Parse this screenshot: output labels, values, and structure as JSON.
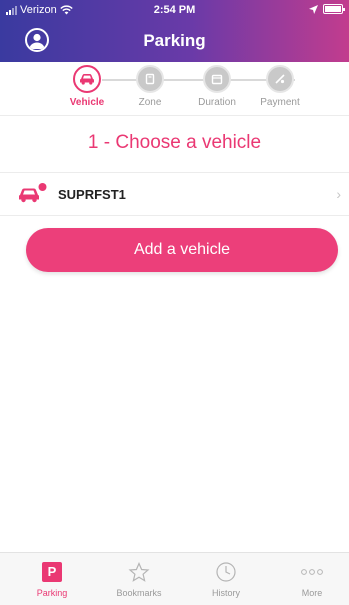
{
  "status_bar": {
    "carrier": "Verizon",
    "time": "2:54 PM"
  },
  "header": {
    "title": "Parking",
    "profile_icon": "user-circle-icon"
  },
  "stepper": {
    "steps": [
      {
        "label": "Vehicle",
        "icon": "car-icon",
        "active": true
      },
      {
        "label": "Zone",
        "icon": "zone-icon",
        "active": false
      },
      {
        "label": "Duration",
        "icon": "calendar-icon",
        "active": false
      },
      {
        "label": "Payment",
        "icon": "card-icon",
        "active": false
      }
    ]
  },
  "main": {
    "section_title": "1 - Choose a vehicle",
    "vehicles": [
      {
        "name": "SUPRFST1",
        "icon": "car-icon"
      }
    ],
    "add_button_label": "Add a vehicle"
  },
  "tab_bar": {
    "tabs": [
      {
        "label": "Parking",
        "icon": "p-badge-icon",
        "active": true
      },
      {
        "label": "Bookmarks",
        "icon": "star-icon",
        "active": false
      },
      {
        "label": "History",
        "icon": "clock-icon",
        "active": false
      },
      {
        "label": "More",
        "icon": "more-icon",
        "active": false
      }
    ]
  },
  "colors": {
    "accent": "#ea3873",
    "header_start": "#3a3aa0",
    "header_end": "#c23c8e"
  }
}
